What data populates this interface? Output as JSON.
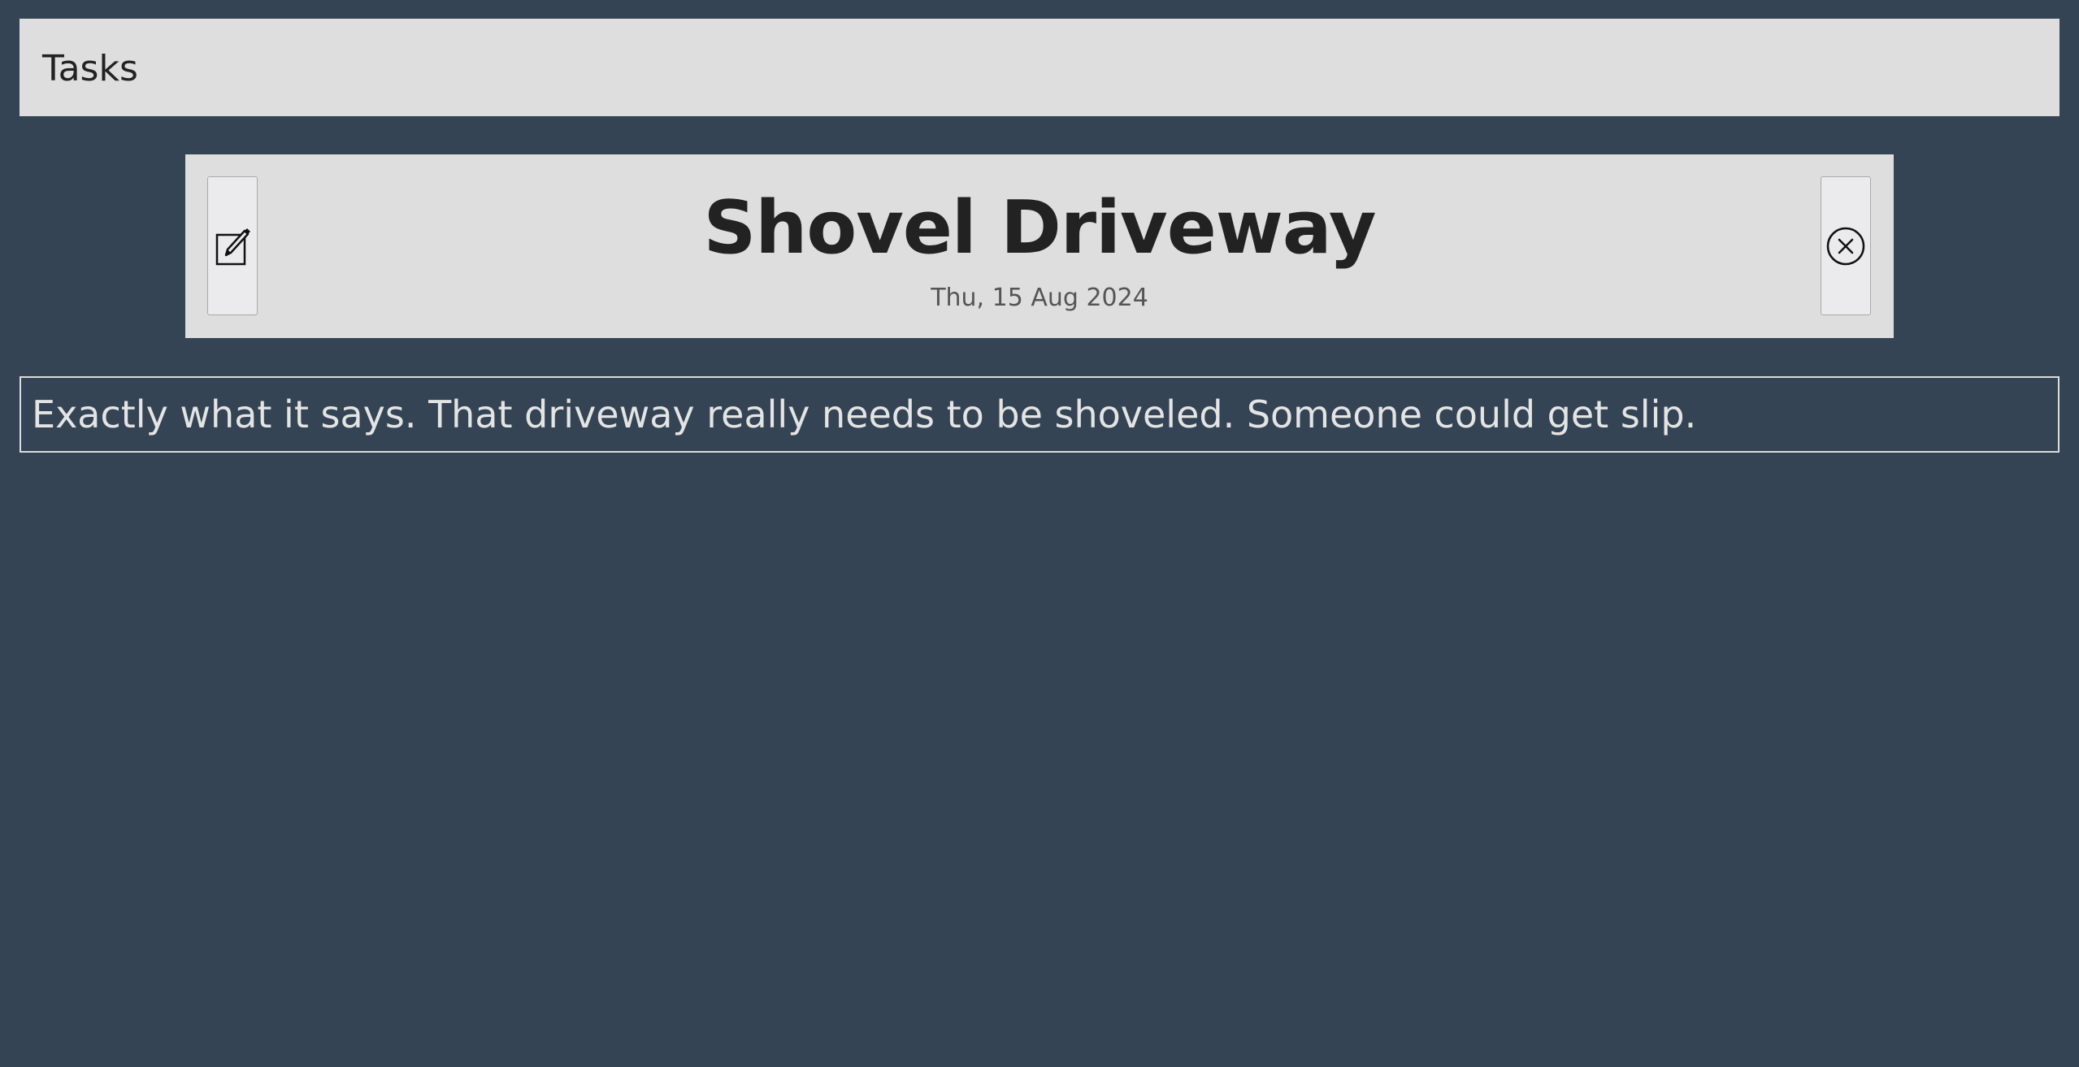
{
  "header": {
    "title": "Tasks"
  },
  "task": {
    "title": "Shovel Driveway",
    "date": "Thu, 15 Aug 2024",
    "description": "Exactly what it says. That driveway really needs to be shoveled. Someone could get slip.",
    "edit_icon": "edit-icon",
    "delete_icon": "close-circle-icon"
  },
  "colors": {
    "background": "#344454",
    "panel": "#dedede",
    "button": "#ebebed",
    "title_text": "#222222",
    "description_text": "#e4e4e4"
  }
}
